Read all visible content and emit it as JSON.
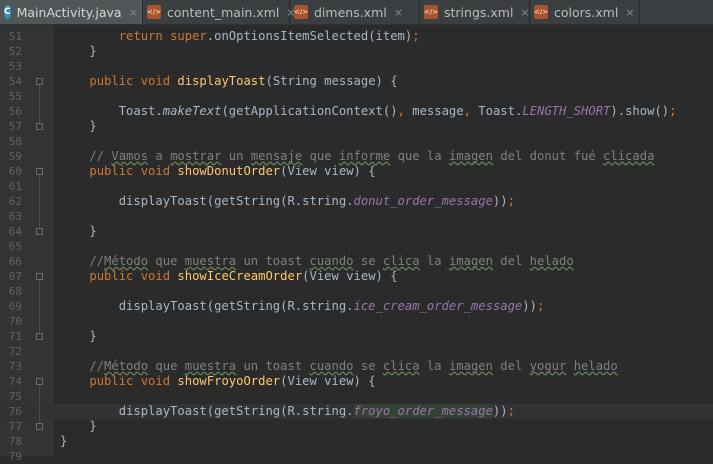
{
  "tabs": [
    {
      "label": "MainActivity.java",
      "type": "java",
      "active": true
    },
    {
      "label": "content_main.xml",
      "type": "xml",
      "active": false
    },
    {
      "label": "dimens.xml",
      "type": "xml",
      "active": false
    },
    {
      "label": "strings.xml",
      "type": "xml",
      "active": false
    },
    {
      "label": "colors.xml",
      "type": "xml",
      "active": false
    }
  ],
  "tab_close_glyph": "×",
  "editor": {
    "current_line": 76,
    "lines": [
      {
        "n": "51",
        "segs": [
          [
            "        ",
            ""
          ],
          [
            "return ",
            "kw"
          ],
          [
            "super",
            "kw"
          ],
          [
            ".onOptionsItemSelected(item)",
            ""
          ],
          [
            ";",
            "kw"
          ]
        ]
      },
      {
        "n": "52",
        "segs": [
          [
            "    }",
            ""
          ]
        ]
      },
      {
        "n": "53",
        "segs": []
      },
      {
        "n": "54",
        "segs": [
          [
            "    ",
            ""
          ],
          [
            "public void ",
            "kw"
          ],
          [
            "displayToast",
            "fn"
          ],
          [
            "(String message) {",
            ""
          ]
        ]
      },
      {
        "n": "55",
        "segs": []
      },
      {
        "n": "56",
        "segs": [
          [
            "        Toast.",
            ""
          ],
          [
            "makeText",
            "it"
          ],
          [
            "(getApplicationContext()",
            ""
          ],
          [
            ", ",
            "kw"
          ],
          [
            "message",
            ""
          ],
          [
            ", ",
            "kw"
          ],
          [
            "Toast.",
            ""
          ],
          [
            "LENGTH_SHORT",
            "cst"
          ],
          [
            ").show()",
            ""
          ],
          [
            ";",
            "kw"
          ]
        ]
      },
      {
        "n": "57",
        "segs": [
          [
            "    }",
            ""
          ]
        ]
      },
      {
        "n": "58",
        "segs": []
      },
      {
        "n": "59",
        "segs": [
          [
            "    // ",
            "cm"
          ],
          [
            "Vamos",
            "cm wv"
          ],
          [
            " a ",
            "cm"
          ],
          [
            "mostrar",
            "cm wv"
          ],
          [
            " un ",
            "cm"
          ],
          [
            "mensaje",
            "cm wv"
          ],
          [
            " que ",
            "cm"
          ],
          [
            "informe",
            "cm wv"
          ],
          [
            " que la ",
            "cm"
          ],
          [
            "imagen",
            "cm wv"
          ],
          [
            " del donut fué ",
            "cm"
          ],
          [
            "clicada",
            "cm wv"
          ]
        ]
      },
      {
        "n": "60",
        "segs": [
          [
            "    ",
            ""
          ],
          [
            "public void ",
            "kw"
          ],
          [
            "showDonutOrder",
            "fn"
          ],
          [
            "(View view) {",
            ""
          ]
        ]
      },
      {
        "n": "61",
        "segs": []
      },
      {
        "n": "62",
        "segs": [
          [
            "        displayToast(getString(R.string.",
            ""
          ],
          [
            "donut_order_message",
            "cst"
          ],
          [
            "))",
            ""
          ],
          [
            ";",
            "kw"
          ]
        ]
      },
      {
        "n": "63",
        "segs": []
      },
      {
        "n": "64",
        "segs": [
          [
            "    }",
            ""
          ]
        ]
      },
      {
        "n": "65",
        "segs": []
      },
      {
        "n": "66",
        "segs": [
          [
            "    //",
            "cm"
          ],
          [
            "Método",
            "cm wv"
          ],
          [
            " que ",
            "cm"
          ],
          [
            "muestra",
            "cm wv"
          ],
          [
            " un toast ",
            "cm"
          ],
          [
            "cuando",
            "cm wv"
          ],
          [
            " se ",
            "cm"
          ],
          [
            "clica",
            "cm wv"
          ],
          [
            " la ",
            "cm"
          ],
          [
            "imagen",
            "cm wv"
          ],
          [
            " del ",
            "cm"
          ],
          [
            "helado",
            "cm wv"
          ]
        ]
      },
      {
        "n": "67",
        "segs": [
          [
            "    ",
            ""
          ],
          [
            "public void ",
            "kw"
          ],
          [
            "showIceCreamOrder",
            "fn"
          ],
          [
            "(View view) {",
            ""
          ]
        ]
      },
      {
        "n": "68",
        "segs": []
      },
      {
        "n": "69",
        "segs": [
          [
            "        displayToast(getString(R.string.",
            ""
          ],
          [
            "ice_cream_order_message",
            "cst"
          ],
          [
            "))",
            ""
          ],
          [
            ";",
            "kw"
          ]
        ]
      },
      {
        "n": "70",
        "segs": []
      },
      {
        "n": "71",
        "segs": [
          [
            "    }",
            ""
          ]
        ]
      },
      {
        "n": "72",
        "segs": []
      },
      {
        "n": "73",
        "segs": [
          [
            "    //",
            "cm"
          ],
          [
            "Método",
            "cm wv"
          ],
          [
            " que ",
            "cm"
          ],
          [
            "muestra",
            "cm wv"
          ],
          [
            " un toast ",
            "cm"
          ],
          [
            "cuando",
            "cm wv"
          ],
          [
            " se ",
            "cm"
          ],
          [
            "clica",
            "cm wv"
          ],
          [
            " la ",
            "cm"
          ],
          [
            "imagen",
            "cm wv"
          ],
          [
            " del ",
            "cm"
          ],
          [
            "yogur",
            "cm wv"
          ],
          [
            " ",
            "cm"
          ],
          [
            "helado",
            "cm wv"
          ]
        ]
      },
      {
        "n": "74",
        "segs": [
          [
            "    ",
            ""
          ],
          [
            "public void ",
            "kw"
          ],
          [
            "showFroyoOrder",
            "fn"
          ],
          [
            "(View view) {",
            ""
          ]
        ]
      },
      {
        "n": "75",
        "segs": []
      },
      {
        "n": "76",
        "segs": [
          [
            "        displayToast(getString(R.string.",
            ""
          ],
          [
            "froyo_order_message",
            "cst hl"
          ],
          [
            "))",
            ""
          ],
          [
            ";",
            "kw"
          ]
        ]
      },
      {
        "n": "77",
        "segs": [
          [
            "    }",
            ""
          ]
        ]
      },
      {
        "n": "78",
        "segs": [
          [
            "}",
            ""
          ]
        ]
      },
      {
        "n": "79",
        "segs": []
      }
    ]
  }
}
